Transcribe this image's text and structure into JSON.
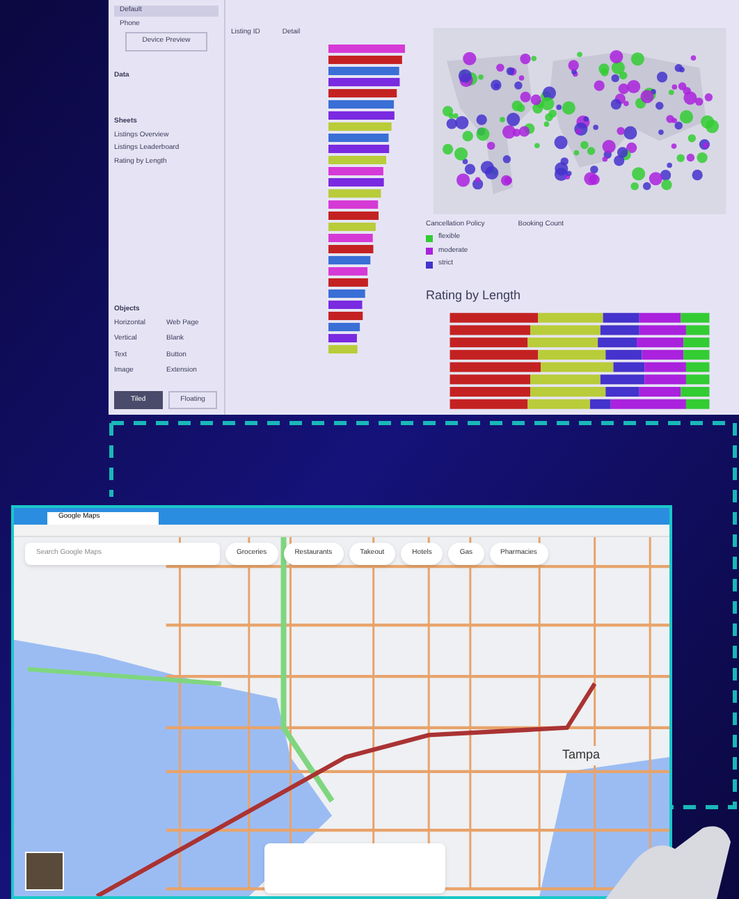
{
  "dashboard": {
    "sidebar": {
      "items": [
        {
          "label": "Default",
          "selected": true
        },
        {
          "label": "Phone",
          "selected": false
        }
      ],
      "preview_button": "Device Preview",
      "data_heading": "Data",
      "sheets_heading": "Sheets",
      "sheets": [
        "Listings Overview",
        "Listings Leaderboard",
        "Rating by Length"
      ],
      "objects_heading": "Objects",
      "objects": [
        "Horizontal",
        "Web Page",
        "Vertical",
        "Blank",
        "Text",
        "Button",
        "Image",
        "Extension"
      ],
      "tabs": [
        {
          "label": "Tiled",
          "selected": true
        },
        {
          "label": "Floating",
          "selected": false
        }
      ]
    },
    "leaderboard": {
      "columns": [
        "Listing ID",
        "Detail"
      ]
    },
    "map": {
      "legend_title": "Cancellation Policy",
      "legend": [
        {
          "label": "flexible",
          "color": "#33cc33"
        },
        {
          "label": "moderate",
          "color": "#aa22dd"
        },
        {
          "label": "strict",
          "color": "#4433cc"
        }
      ],
      "size_title": "Booking Count"
    },
    "rating": {
      "title": "Rating by Length"
    }
  },
  "browser": {
    "tab": "Google Maps",
    "search_placeholder": "Search Google Maps",
    "chips": [
      "Groceries",
      "Restaurants",
      "Takeout",
      "Hotels",
      "Gas",
      "Pharmacies"
    ],
    "map_label": "Tampa"
  }
}
